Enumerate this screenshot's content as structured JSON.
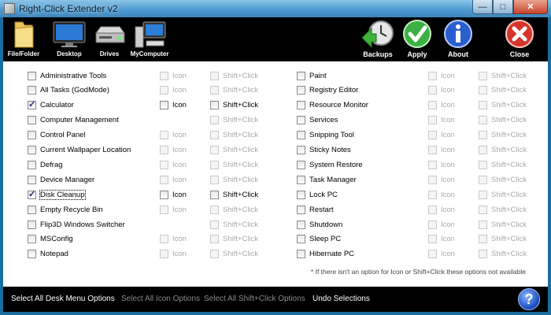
{
  "window": {
    "title": "Right-Click Extender v2"
  },
  "toolbar": {
    "file_folder": "File/Folder",
    "desktop": "Desktop",
    "drives": "Drives",
    "mycomputer": "MyComputer",
    "backups": "Backups",
    "apply": "Apply",
    "about": "About",
    "close": "Close"
  },
  "options": {
    "icon": "Icon",
    "shift_click": "Shift+Click"
  },
  "left_items": [
    {
      "label": "Administrative Tools",
      "checked": false,
      "icon": true,
      "shift": true
    },
    {
      "label": "All Tasks (GodMode)",
      "checked": false,
      "icon": true,
      "shift": true
    },
    {
      "label": "Calculator",
      "checked": true,
      "icon": true,
      "shift": true,
      "active": true
    },
    {
      "label": "Computer Management",
      "checked": false,
      "icon": false,
      "shift": true
    },
    {
      "label": "Control Panel",
      "checked": false,
      "icon": true,
      "shift": true
    },
    {
      "label": "Current Wallpaper Location",
      "checked": false,
      "icon": true,
      "shift": true
    },
    {
      "label": "Defrag",
      "checked": false,
      "icon": true,
      "shift": true
    },
    {
      "label": "Device Manager",
      "checked": false,
      "icon": true,
      "shift": true
    },
    {
      "label": "Disk Cleanup",
      "checked": true,
      "icon": true,
      "shift": true,
      "active": true,
      "focus": true
    },
    {
      "label": "Empty Recycle Bin",
      "checked": false,
      "icon": true,
      "shift": true
    },
    {
      "label": "Flip3D Windows Switcher",
      "checked": false,
      "icon": false,
      "shift": true
    },
    {
      "label": "MSConfig",
      "checked": false,
      "icon": true,
      "shift": true
    },
    {
      "label": "Notepad",
      "checked": false,
      "icon": true,
      "shift": true
    }
  ],
  "right_items": [
    {
      "label": "Paint",
      "checked": false,
      "icon": true,
      "shift": true
    },
    {
      "label": "Registry Editor",
      "checked": false,
      "icon": true,
      "shift": true
    },
    {
      "label": "Resource Monitor",
      "checked": false,
      "icon": true,
      "shift": true
    },
    {
      "label": "Services",
      "checked": false,
      "icon": true,
      "shift": true
    },
    {
      "label": "Snipping Tool",
      "checked": false,
      "icon": true,
      "shift": true
    },
    {
      "label": "Sticky Notes",
      "checked": false,
      "icon": true,
      "shift": true
    },
    {
      "label": "System Restore",
      "checked": false,
      "icon": true,
      "shift": true
    },
    {
      "label": "Task Manager",
      "checked": false,
      "icon": true,
      "shift": true
    },
    {
      "label": "Lock PC",
      "checked": false,
      "icon": true,
      "shift": true
    },
    {
      "label": "Restart",
      "checked": false,
      "icon": true,
      "shift": true
    },
    {
      "label": "Shutdown",
      "checked": false,
      "icon": true,
      "shift": true
    },
    {
      "label": "Sleep PC",
      "checked": false,
      "icon": true,
      "shift": true
    },
    {
      "label": "Hibernate PC",
      "checked": false,
      "icon": true,
      "shift": true
    }
  ],
  "note": "* If there isn't an option for Icon or Shift+Click these options not available",
  "bottom": {
    "select_all_desk": "Select All Desk Menu Options",
    "select_all_icon": "Select All Icon Options",
    "select_all_shift": "Select All Shift+Click Options",
    "undo": "Undo Selections"
  },
  "colors": {
    "accent": "#1a6ea0",
    "toolbar_bg": "#000000",
    "disabled_text": "#a9a9a9"
  }
}
